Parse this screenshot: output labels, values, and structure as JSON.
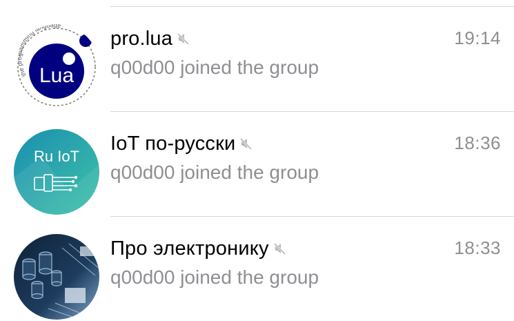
{
  "chats": [
    {
      "title": "pro.lua",
      "time": "19:14",
      "message": "q00d00 joined the group",
      "muted": true,
      "avatar": {
        "icon": "lua-logo",
        "ring_text": "the programming language",
        "logo_text": "Lua",
        "colors": {
          "circle": "#000080",
          "ring": "#7f7f7f"
        }
      }
    },
    {
      "title": "IoT по-русски",
      "time": "18:36",
      "message": "q00d00 joined the group",
      "muted": true,
      "avatar": {
        "icon": "ru-iot-logo",
        "logo_text": "Ru IoT",
        "colors": {
          "gradient_start": "#1a8fb0",
          "gradient_end": "#3fc1a8"
        }
      }
    },
    {
      "title": "Про электронику",
      "time": "18:33",
      "message": "q00d00 joined the group",
      "muted": true,
      "avatar": {
        "icon": "circuit-board-photo",
        "colors": {
          "base": "#1d3c5e",
          "highlight": "#7fa8cc"
        }
      }
    }
  ],
  "colors": {
    "title": "#000000",
    "secondary_text": "#8e8e93",
    "divider": "#d6d6d9",
    "mute_icon": "#b8b8bd"
  }
}
